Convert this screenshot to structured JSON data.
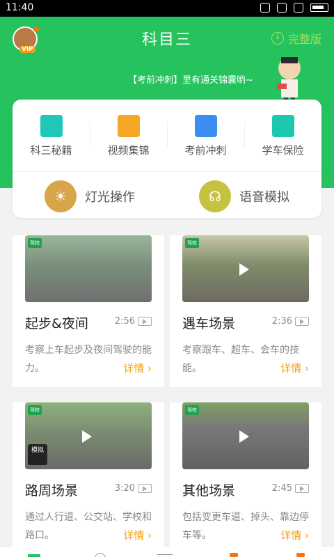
{
  "status_bar": {
    "time": "11:40"
  },
  "header": {
    "title": "科目三",
    "full_version": "完整版",
    "slogan": "【考前冲刺】里有通关锦囊哟~",
    "avatar_badge": "VIP"
  },
  "menu": {
    "items": [
      {
        "label": "科三秘籍",
        "icon": "book-icon",
        "color": "#20c7b8"
      },
      {
        "label": "视频集锦",
        "icon": "video-icon",
        "color": "#f5a623"
      },
      {
        "label": "考前冲刺",
        "icon": "pen-icon",
        "color": "#3b8ef0"
      },
      {
        "label": "学车保险",
        "icon": "key-icon",
        "color": "#1cc8b0"
      }
    ],
    "lights": {
      "label": "灯光操作",
      "icon": "sun-icon",
      "color": "#d9a54a"
    },
    "voice": {
      "label": "语音模拟",
      "icon": "headset-icon",
      "color": "#c6c241"
    }
  },
  "videos": [
    {
      "title": "起步&夜间",
      "duration": "2:56",
      "desc": "考察上车起步及夜间驾驶的能力。",
      "detail": "详情 ›"
    },
    {
      "title": "遇车场景",
      "duration": "2:36",
      "desc": "考察跟车、超车、会车的技能。",
      "detail": "详情 ›"
    },
    {
      "title": "路周场景",
      "duration": "3:20",
      "desc": "通过人行道、公交站、学校和路口。",
      "detail": "详情 ›",
      "sim_label": "模拟"
    },
    {
      "title": "其他场景",
      "duration": "2:45",
      "desc": "包括变更车道、掉头、靠边停车等。",
      "detail": "详情 ›"
    }
  ],
  "colors": {
    "brand_green": "#25c25e",
    "accent_orange": "#f59e0b"
  }
}
